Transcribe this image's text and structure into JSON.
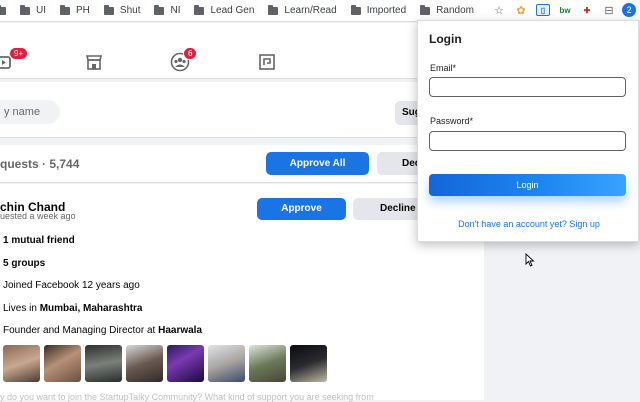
{
  "bookmarks": [
    {
      "label": ""
    },
    {
      "label": "UI"
    },
    {
      "label": "PH"
    },
    {
      "label": "Shut"
    },
    {
      "label": "NI"
    },
    {
      "label": "Lead Gen"
    },
    {
      "label": "Learn/Read"
    },
    {
      "label": "Imported"
    },
    {
      "label": "Random"
    }
  ],
  "extensions": {
    "badge_count": "2",
    "ext_bw": "bw"
  },
  "nav": {
    "watch_badge": "9+",
    "groups_badge": "6"
  },
  "search": {
    "placeholder": "y name",
    "sug_label": "Sug"
  },
  "requests": {
    "title": "quests · 5,744",
    "approve_all": "Approve All",
    "decline_all": "Dec"
  },
  "member": {
    "name": "chin Chand",
    "requested": "uested a week ago",
    "approve": "Approve",
    "decline": "Decline",
    "mutual": "1 mutual friend",
    "groups": "5 groups",
    "joined": "Joined Facebook 12 years ago",
    "lives_prefix": "Lives in ",
    "lives_place": "Mumbai, Maharashtra",
    "work_prefix": "Founder and Managing Director at ",
    "work_place": "Haarwala",
    "question": "y do you want to join the StartupTalky Community? What kind of support you are seeking from"
  },
  "login": {
    "title": "Login",
    "email_label": "Email*",
    "password_label": "Password*",
    "button": "Login",
    "signup": "Don't have an account yet? Sign up"
  },
  "colors": {
    "fb_blue": "#1b74e4",
    "badge_red": "#e41e3f",
    "login_gradient_start": "#1565d8",
    "login_gradient_end": "#3aa3ff",
    "link_blue": "#1a73e8"
  },
  "icons": [
    "folder-icon",
    "star-icon",
    "watch-icon",
    "marketplace-icon",
    "groups-icon",
    "gaming-icon",
    "cursor-icon"
  ]
}
